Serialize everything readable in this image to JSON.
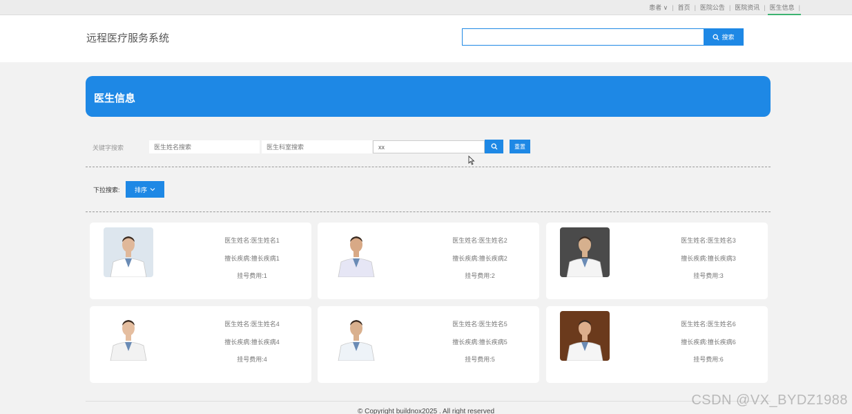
{
  "topnav": {
    "items": [
      {
        "label": "患者 ∨",
        "active": false
      },
      {
        "label": "首页",
        "active": false
      },
      {
        "label": "医院公告",
        "active": false
      },
      {
        "label": "医院资讯",
        "active": false
      },
      {
        "label": "医生信息",
        "active": true
      }
    ],
    "separator": "|",
    "active_color": "#3cb371"
  },
  "header": {
    "site_title": "远程医疗服务系统",
    "search_value": "",
    "search_button": "搜索"
  },
  "banner": {
    "title": "医生信息",
    "color": "#1e88e5"
  },
  "filters": {
    "label": "关键字搜索",
    "name_placeholder": "医生姓名搜索",
    "dept_placeholder": "医生科室搜索",
    "third_value": "xx",
    "reset_label": "重置"
  },
  "dropdown": {
    "label": "下拉搜索:",
    "sort_label": "排序"
  },
  "doctors": [
    {
      "name": "医生姓名:医生姓名1",
      "specialty": "擅长疾病:擅长疾病1",
      "fee": "挂号费用:1",
      "photo_bg": "#dde6ee",
      "coat": "#ffffff",
      "skin": "#e0b89a"
    },
    {
      "name": "医生姓名:医生姓名2",
      "specialty": "擅长疾病:擅长疾病2",
      "fee": "挂号费用:2",
      "photo_bg": "#ffffff",
      "coat": "#e6e6f5",
      "skin": "#d8a986"
    },
    {
      "name": "医生姓名:医生姓名3",
      "specialty": "擅长疾病:擅长疾病3",
      "fee": "挂号费用:3",
      "photo_bg": "#4a4a4a",
      "coat": "#f4f4f4",
      "skin": "#d6b08e"
    },
    {
      "name": "医生姓名:医生姓名4",
      "specialty": "擅长疾病:擅长疾病4",
      "fee": "挂号费用:4",
      "photo_bg": "#ffffff",
      "coat": "#f2f2f2",
      "skin": "#e5bea0"
    },
    {
      "name": "医生姓名:医生姓名5",
      "specialty": "擅长疾病:擅长疾病5",
      "fee": "挂号费用:5",
      "photo_bg": "#ffffff",
      "coat": "#eef3f8",
      "skin": "#d9b08e"
    },
    {
      "name": "医生姓名:医生姓名6",
      "specialty": "擅长疾病:擅长疾病6",
      "fee": "挂号费用:6",
      "photo_bg": "#6b3a1c",
      "coat": "#f5f5f5",
      "skin": "#dcae8c"
    }
  ],
  "footer": {
    "copyright": "© Copyright buildnox2025 . All right reserved"
  },
  "watermark": "CSDN @VX_BYDZ1988",
  "colors": {
    "accent": "#1e88e5",
    "page_bg": "#f2f2f2"
  }
}
